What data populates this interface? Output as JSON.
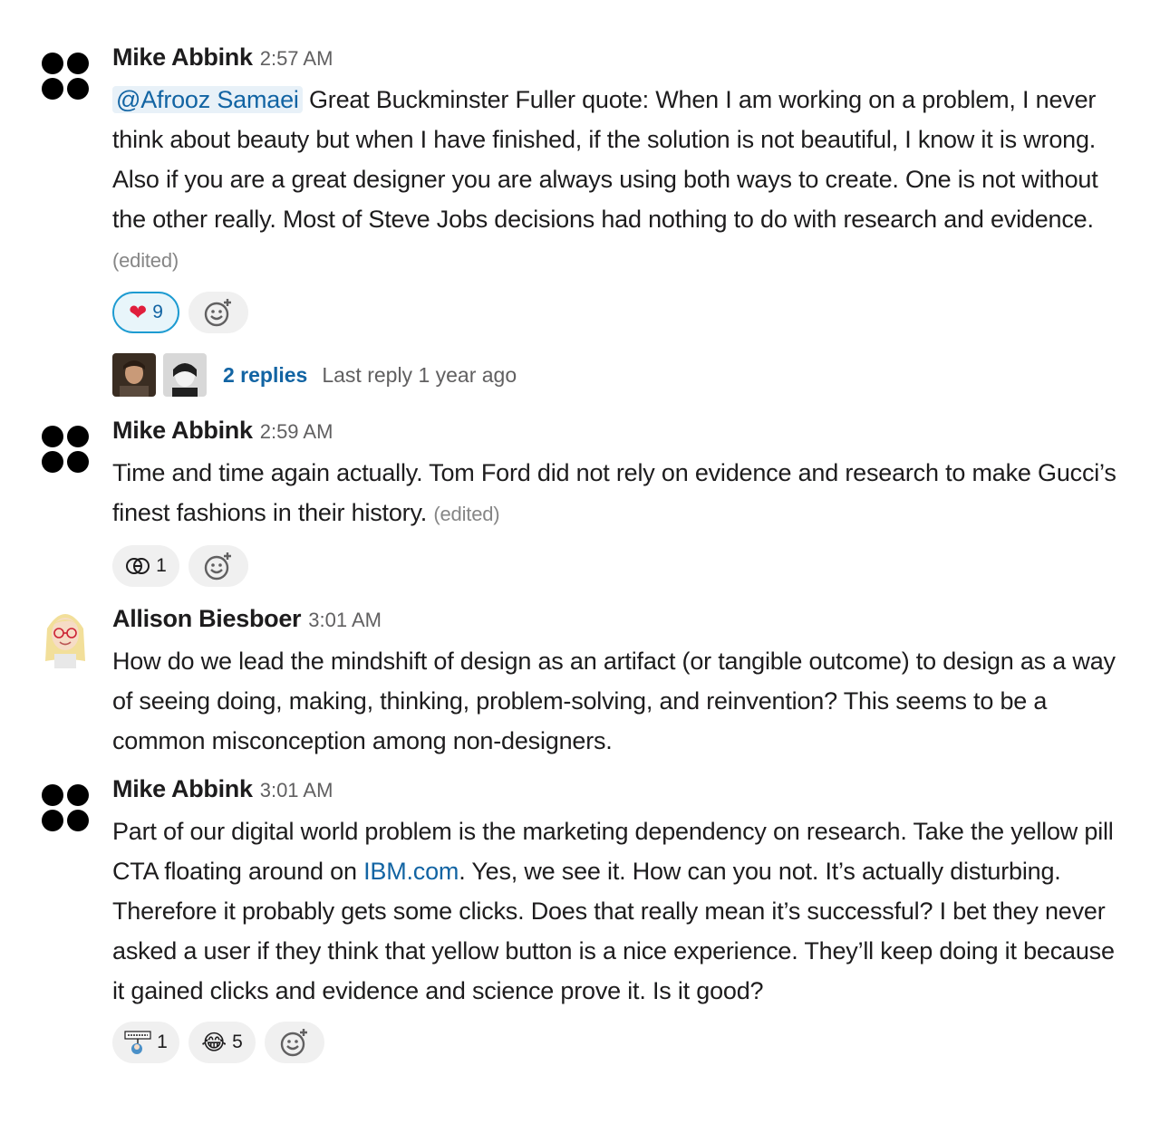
{
  "messages": [
    {
      "author": "Mike Abbink",
      "time": "2:57 AM",
      "mention": "@Afrooz Samaei",
      "text": " Great Buckminster Fuller quote: When I am working on a problem, I never think about beauty but when I have finished, if the solution is not beautiful, I know it is wrong. Also if you are a great designer you are always using both ways to create. One is not without the other really. Most of Steve Jobs decisions had nothing to do with research and evidence.",
      "edited": "(edited)",
      "reactions": [
        {
          "emoji": "❤️",
          "icon": "heart-icon",
          "count": "9",
          "active": true
        }
      ],
      "thread": {
        "replies": "2 replies",
        "last_reply": "Last reply 1 year ago"
      }
    },
    {
      "author": "Mike Abbink",
      "time": "2:59 AM",
      "text": "Time and time again actually. Tom Ford did not rely on evidence and research to make Gucci’s finest fashions in their history.",
      "edited": "(edited)",
      "reactions": [
        {
          "emoji": "gucci",
          "icon": "gucci-logo-icon",
          "count": "1",
          "active": false
        }
      ]
    },
    {
      "author": "Allison Biesboer",
      "time": "3:01 AM",
      "text": "How do we lead the mindshift of design as an artifact (or tangible outcome) to design as a way of seeing doing, making, thinking, problem-solving, and reinvention? This seems to be a common misconception among non-designers."
    },
    {
      "author": "Mike Abbink",
      "time": "3:01 AM",
      "text_before_link": "Part of our digital world problem is the marketing dependency on research. Take the yellow pill CTA floating around on ",
      "link": "IBM.com",
      "text_after_link": ". Yes, we see it. How can you not. It’s actually disturbing. Therefore it probably gets some clicks. Does that really mean it’s successful? I bet they never asked a user if they think that yellow button is a nice experience. They’ll keep doing it because it gained clicks and evidence and science prove it. Is it good?",
      "reactions": [
        {
          "emoji": "thank-you",
          "icon": "thank-you-icon",
          "count": "1",
          "active": false
        },
        {
          "emoji": "😂",
          "icon": "joy-icon",
          "count": "5",
          "active": false
        }
      ]
    }
  ]
}
